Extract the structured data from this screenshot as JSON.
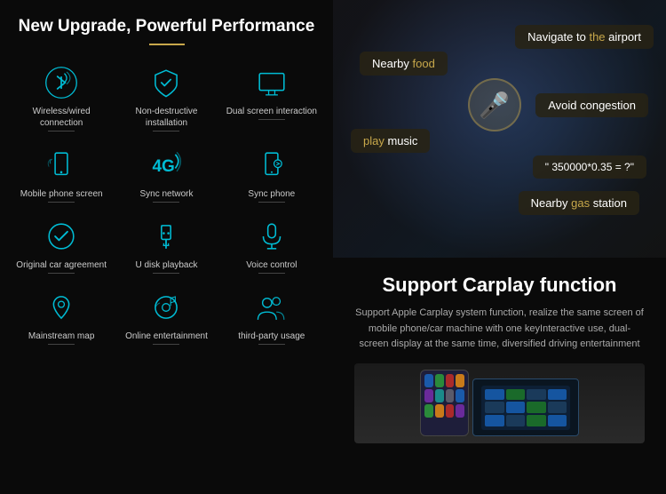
{
  "left": {
    "title": "New Upgrade, Powerful Performance",
    "features": [
      {
        "label": "Wireless/wired connection",
        "icon": "bluetooth"
      },
      {
        "label": "Non-destructive installation",
        "icon": "shield"
      },
      {
        "label": "Dual screen interaction",
        "icon": "dual-screen"
      },
      {
        "label": "Mobile phone screen",
        "icon": "mobile"
      },
      {
        "label": "Sync network",
        "icon": "4g"
      },
      {
        "label": "Sync phone",
        "icon": "sync-phone"
      },
      {
        "label": "Original car agreement",
        "icon": "check-circle"
      },
      {
        "label": "U disk playback",
        "icon": "usb"
      },
      {
        "label": "Voice control",
        "icon": "mic"
      },
      {
        "label": "Mainstream map",
        "icon": "map"
      },
      {
        "label": "Online entertainment",
        "icon": "entertainment"
      },
      {
        "label": "third-party usage",
        "icon": "users"
      }
    ]
  },
  "right": {
    "bubbles": [
      {
        "id": "navigate",
        "text_before": "Navigate to ",
        "highlight": "the",
        "text_after": " airport",
        "full": "Navigate to the airport"
      },
      {
        "id": "food",
        "text_before": "Nearby ",
        "highlight": "food",
        "text_after": "",
        "full": "Nearby food"
      },
      {
        "id": "avoid",
        "text_before": "Avoid congestion",
        "highlight": "",
        "text_after": "",
        "full": "Avoid congestion"
      },
      {
        "id": "play",
        "text_before": "",
        "highlight": "play",
        "text_after": " music",
        "full": "play music"
      },
      {
        "id": "calc",
        "text_before": "\" 350000*0.35 = ?\"",
        "highlight": "",
        "text_after": "",
        "full": "\" 350000*0.35 = ?\""
      },
      {
        "id": "gas",
        "text_before": "Nearby ",
        "highlight": "gas",
        "text_after": " station",
        "full": "Nearby gas station"
      }
    ],
    "carplay_section": {
      "title": "Support Carplay function",
      "description": "Support Apple Carplay system function, realize the same screen of mobile phone/car machine with one keyInteractive use, dual-screen display at the same time, diversified driving entertainment"
    }
  }
}
